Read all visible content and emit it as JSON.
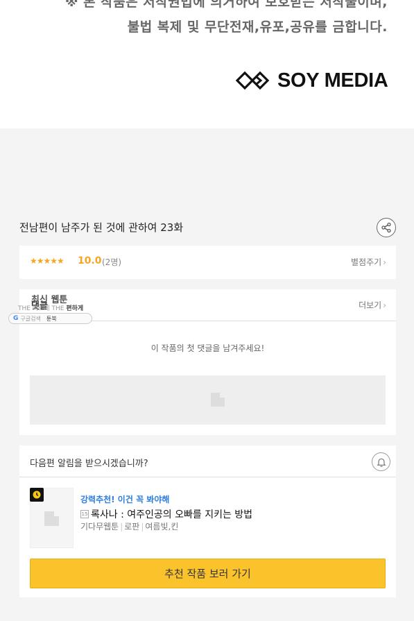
{
  "copyright": {
    "line1": "※ 본 작품은 저작권법에 의거하여 보호받는 저작물이며,",
    "line2": "불법 복제 및 무단전재,유포,공유를 금합니다."
  },
  "publisher_logo": {
    "text": "SOY MEDIA"
  },
  "episode": {
    "title": "전남편이 남주가 된 것에 관하여 23화",
    "share_icon": "share-icon"
  },
  "rating": {
    "stars": "★★★★★",
    "score": "10.0",
    "count": "(2명)",
    "rate_link": "별점주기",
    "chevron": "›",
    "accent": "#f5a623"
  },
  "comments": {
    "title": "댓글",
    "more_link": "더보기",
    "chevron": "›",
    "empty_message": "이 작품의 첫 댓글을 남겨주세요!"
  },
  "overlay": {
    "label": "최신 웹툰",
    "sub_prefix": "THE 빠르게 THE",
    "sub_bold": "편하게",
    "pill_icon": "G",
    "pill_text": "구글검색",
    "pill_extra": "툰북"
  },
  "next_notice": {
    "question": "다음편 알림을 받으시겠습니까?",
    "bell_icon": "bell-icon"
  },
  "recommendation": {
    "tag": "강력추천! 이건 꼭 봐야해",
    "age_badge": "15",
    "title": "록사나 : 여주인공의 오빠를 지키는 방법",
    "meta": [
      "기다무웹툰",
      "로판",
      "여름빛,킨"
    ],
    "button_label": "추천 작품 보러 가기",
    "tag_color": "#2a7de1",
    "button_color": "#fbc32b"
  }
}
